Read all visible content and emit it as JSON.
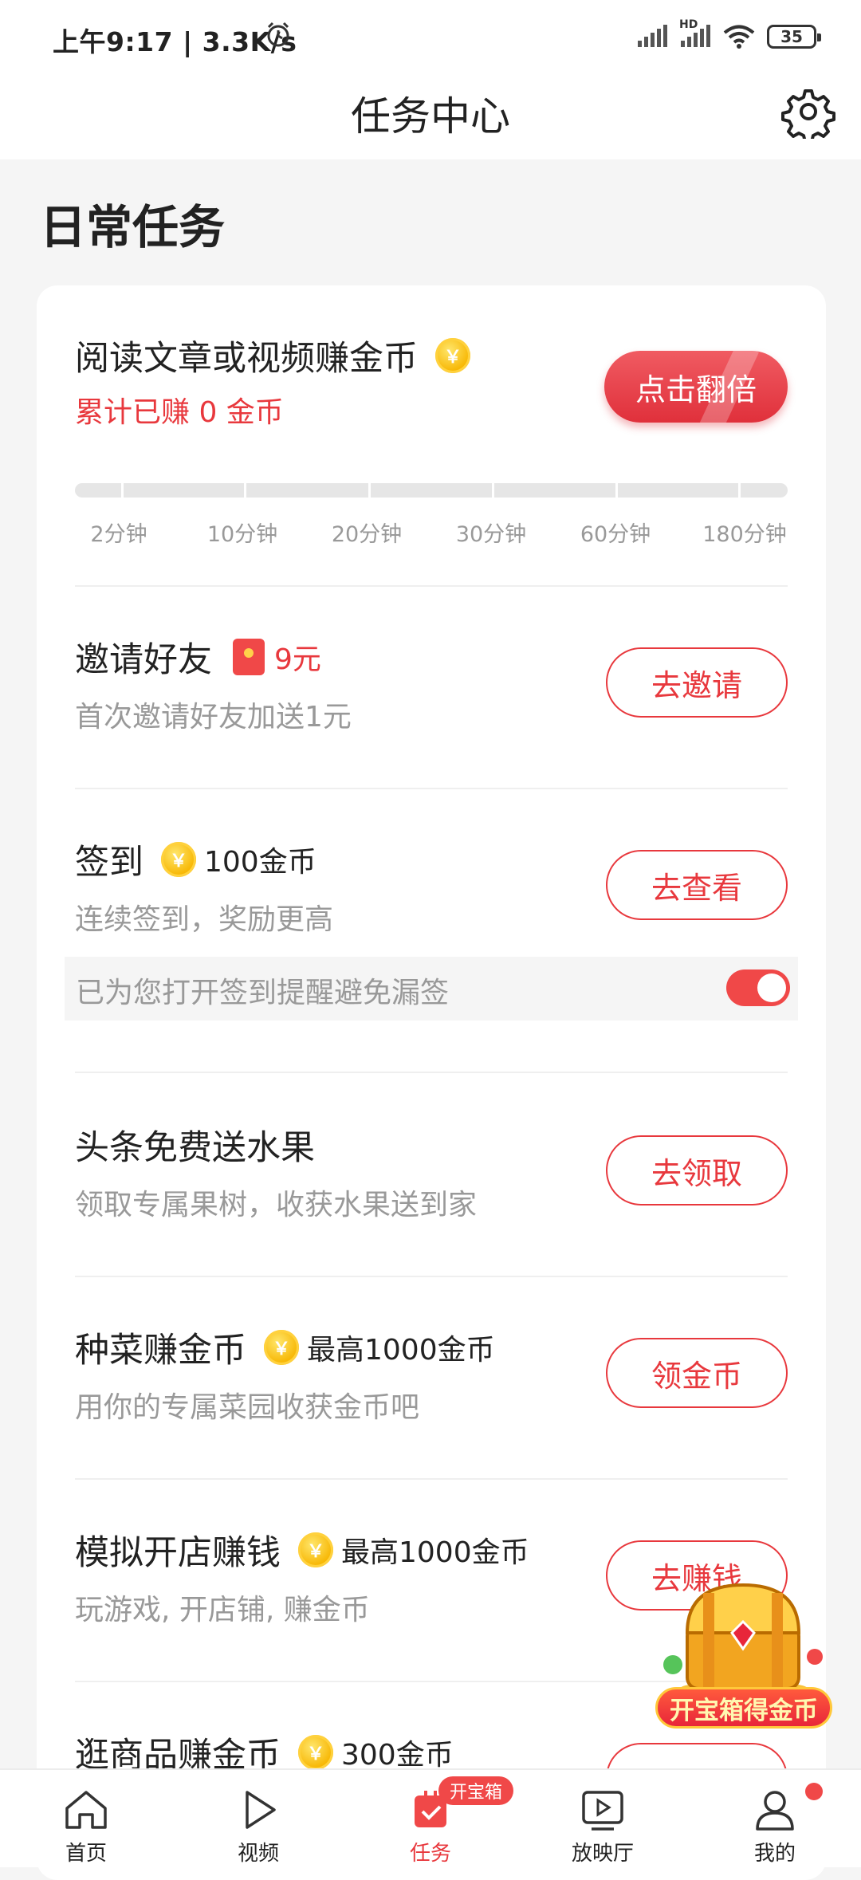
{
  "status_bar": {
    "time": "上午9:17 | 3.3K/s",
    "battery": "35",
    "network_label": "HD"
  },
  "header": {
    "title": "任务中心"
  },
  "section": {
    "title": "日常任务"
  },
  "tasks": {
    "read": {
      "title": "阅读文章或视频赚金币",
      "desc": "累计已赚 0 金币",
      "button": "点击翻倍",
      "progress_value": 0,
      "milestones": [
        "2分钟",
        "10分钟",
        "20分钟",
        "30分钟",
        "60分钟",
        "180分钟"
      ]
    },
    "invite": {
      "title": "邀请好友",
      "reward": "9元",
      "desc": "首次邀请好友加送1元",
      "button": "去邀请"
    },
    "checkin": {
      "title": "签到",
      "reward": "100金币",
      "desc": "连续签到，奖励更高",
      "button": "去查看",
      "reminder": "已为您打开签到提醒避免漏签",
      "reminder_on": true
    },
    "fruit": {
      "title": "头条免费送水果",
      "desc": "领取专属果树，收获水果送到家",
      "button": "去领取"
    },
    "garden": {
      "title": "种菜赚金币",
      "reward": "最高1000金币",
      "desc": "用你的专属菜园收获金币吧",
      "button": "领金币"
    },
    "shop": {
      "title": "模拟开店赚钱",
      "reward": "最高1000金币",
      "desc": "玩游戏, 开店铺, 赚金币",
      "button": "去赚钱"
    },
    "browse": {
      "title": "逛商品赚金币",
      "reward": "300金币"
    }
  },
  "coin_symbol": "￥",
  "treasure": {
    "label": "开宝箱得金币"
  },
  "bottom_nav": {
    "items": [
      {
        "label": "首页"
      },
      {
        "label": "视频"
      },
      {
        "label": "任务",
        "badge": "开宝箱"
      },
      {
        "label": "放映厅"
      },
      {
        "label": "我的"
      }
    ]
  },
  "colors": {
    "accent": "#e8383d",
    "coin": "#f7b500",
    "background": "#f5f5f5"
  }
}
